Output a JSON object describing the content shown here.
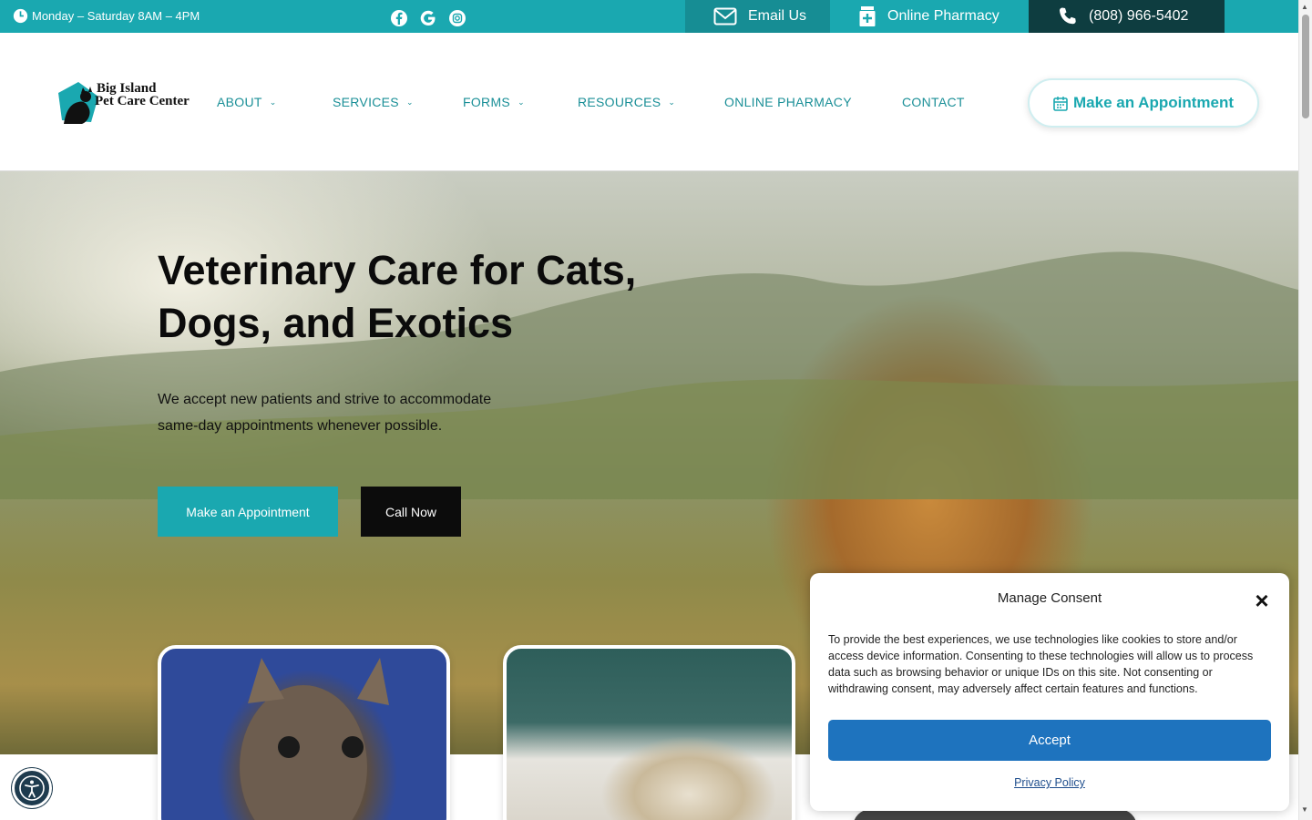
{
  "topbar": {
    "hours": "Monday – Saturday 8AM – 4PM",
    "social_icons": [
      "facebook-icon",
      "google-icon",
      "instagram-icon"
    ],
    "email_label": "Email Us",
    "pharmacy_label": "Online Pharmacy",
    "phone_label": "(808) 966-5402"
  },
  "header": {
    "logo_line1": "Big Island",
    "logo_line2": "Pet Care Center",
    "nav": [
      {
        "label": "ABOUT",
        "has_dropdown": true
      },
      {
        "label": "SERVICES",
        "has_dropdown": true
      },
      {
        "label": "FORMS",
        "has_dropdown": true
      },
      {
        "label": "RESOURCES",
        "has_dropdown": true
      },
      {
        "label": "ONLINE PHARMACY",
        "has_dropdown": false
      },
      {
        "label": "CONTACT",
        "has_dropdown": false
      }
    ],
    "appointment_label": "Make an Appointment"
  },
  "hero": {
    "title_line1": "Veterinary Care for Cats,",
    "title_line2": "Dogs, and Exotics",
    "text_line1": "We accept new patients and strive to accommodate",
    "text_line2": "same-day appointments whenever possible.",
    "primary_button": "Make an Appointment",
    "secondary_button": "Call Now"
  },
  "consent": {
    "title": "Manage Consent",
    "close": "×",
    "body": "To provide the best experiences, we use technologies like cookies to store and/or access device information. Consenting to these technologies will allow us to process data such as browsing behavior or unique IDs on this site. Not consenting or withdrawing consent, may adversely affect certain features and functions.",
    "accept_label": "Accept",
    "privacy_label": "Privacy Policy"
  },
  "colors": {
    "brand_teal": "#1aa8b0",
    "dark_teal": "#0e3d40",
    "accept_blue": "#1e73be"
  }
}
